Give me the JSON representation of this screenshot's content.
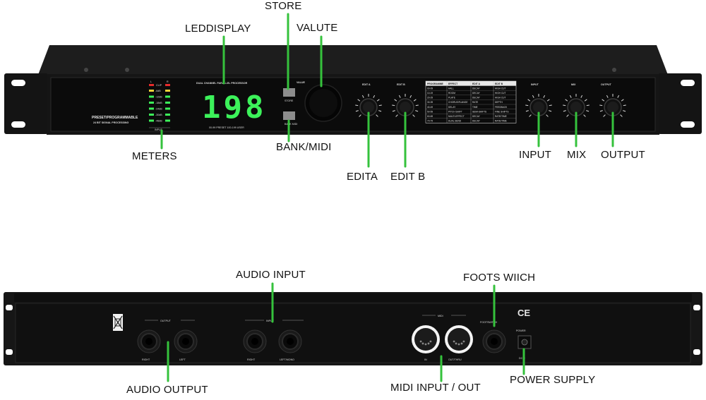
{
  "front_panel": {
    "brand_line1": "PRESET/PROGRAMMABLE",
    "brand_line2": "24 BIT SIGNAL PROCESSING",
    "processor_title": "DUAL CHANNEL PARALLEL PROCESSOR",
    "display_value": "198",
    "preset_note": "00-99 PRESET 100-199 USER",
    "value_label": "VALUE",
    "store_button_label": "STORE",
    "bank_button_label": "BANK MIDI",
    "meter_top_labels": [
      "L",
      "R"
    ],
    "meter_clip_label": "CLIP",
    "meter_levels": [
      "-6dB",
      "-12dB",
      "-18dB",
      "-24dB",
      "-30dB",
      "-48dB"
    ],
    "meter_input_label": "INPUT",
    "knobs": {
      "edit_a": "EDIT A",
      "edit_b": "EDIT B",
      "input": "INPUT",
      "mix": "MIX",
      "output": "OUTPUT"
    },
    "preset_table": {
      "headers": [
        "PROGRAMME",
        "EFFECT",
        "EDIT A",
        "EDIT B"
      ],
      "rows": [
        [
          "00-09",
          "HALL",
          "DECAY",
          "HIGH CUT"
        ],
        [
          "10-19",
          "ROOM",
          "DECAY",
          "HIGH CUT"
        ],
        [
          "20-29",
          "PLATE",
          "DECAY",
          "HIGH CUT"
        ],
        [
          "30-39",
          "CHORUS/FLANGE",
          "RATE",
          "DEPTH"
        ],
        [
          "40-49",
          "DELAY",
          "TIME",
          "FEEDBACK"
        ],
        [
          "50-59",
          "PITCH SHIFT",
          "SEMI-SHIFTS",
          "FINE SHIFTS"
        ],
        [
          "60-69",
          "MULTI-EFFECT",
          "DECAY",
          "RATE/TIME"
        ],
        [
          "70-79",
          "DUAL SEND",
          "DECAY",
          "RATE/TIME"
        ]
      ]
    }
  },
  "rear_panel": {
    "output_group_label": "OUTPUT",
    "input_group_label": "INPUT",
    "midi_group_label": "MIDI",
    "output_right": "RIGHT",
    "output_left": "LEFT",
    "input_right": "RIGHT",
    "input_left": "LEFT/MONO",
    "midi_in": "IN",
    "midi_out": "OUT/THRU",
    "footswitch_label": "FOOTSWITCH",
    "power_label": "POWER",
    "dc_label": "DCIN",
    "ce_mark": "CE"
  },
  "callouts": {
    "store": "STORE",
    "leddisplay": "LEDDISPLAY",
    "valute": "VALUTE",
    "meters": "METERS",
    "bank_midi": "BANK/MIDI",
    "edita": "EDITA",
    "edit_b": "EDIT B",
    "input": "INPUT",
    "mix": "MIX",
    "output": "OUTPUT",
    "audio_input": "AUDIO INPUT",
    "foots_wiich": "FOOTS WIICH",
    "audio_output": "AUDIO OUTPUT",
    "midi_input_out": "MIDI  INPUT / OUT",
    "power_supply": "POWER SUPPLY"
  },
  "colors": {
    "chassis": "#151515",
    "panel": "#0b0b0b",
    "led_green": "#3cf25a",
    "callout_line": "#35c23c",
    "meter_red": "#e52b2b",
    "meter_yellow": "#f0d23a"
  }
}
